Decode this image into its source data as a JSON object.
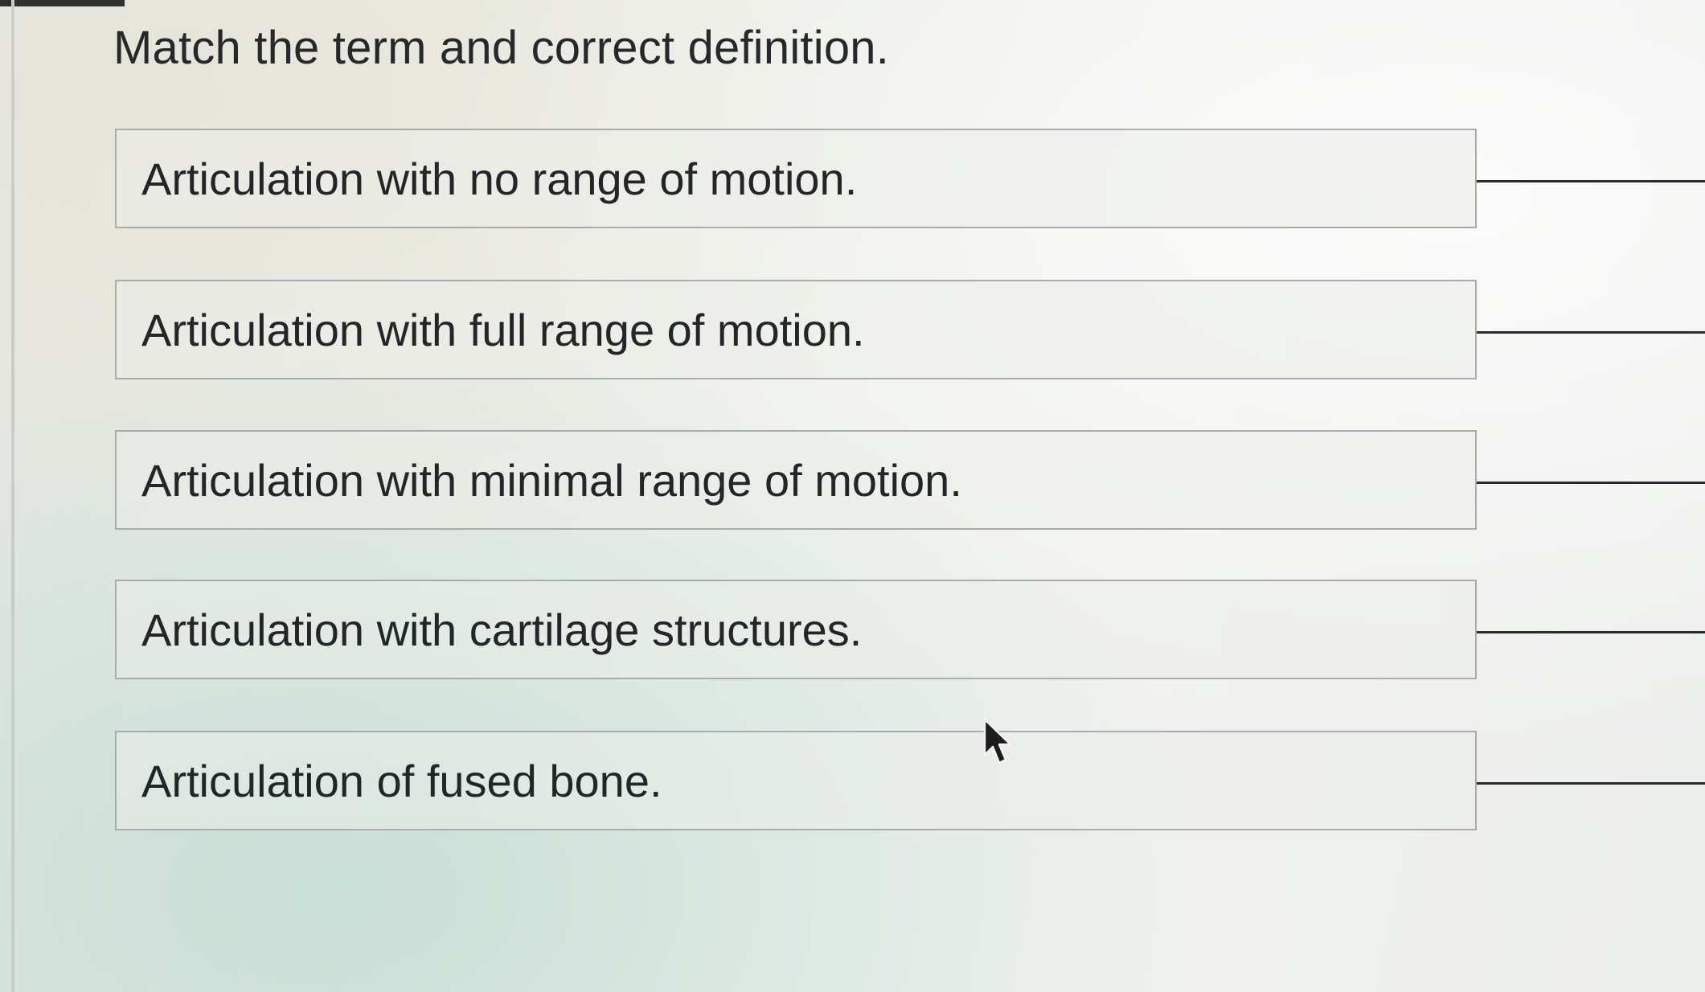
{
  "question": {
    "prompt": "Match the term and correct definition."
  },
  "definitions": [
    {
      "text": "Articulation with no range of motion.",
      "selected_term": ""
    },
    {
      "text": "Articulation with full range of motion.",
      "selected_term": ""
    },
    {
      "text": "Articulation with minimal range of motion.",
      "selected_term": ""
    },
    {
      "text": "Articulation with cartilage structures.",
      "selected_term": ""
    },
    {
      "text": "Articulation of fused bone.",
      "selected_term": ""
    }
  ],
  "icons": {
    "cursor": "mouse-pointer-icon"
  },
  "colors": {
    "text": "#232628",
    "box_border": "#a9acaa",
    "answer_line": "#2a2c2c"
  }
}
